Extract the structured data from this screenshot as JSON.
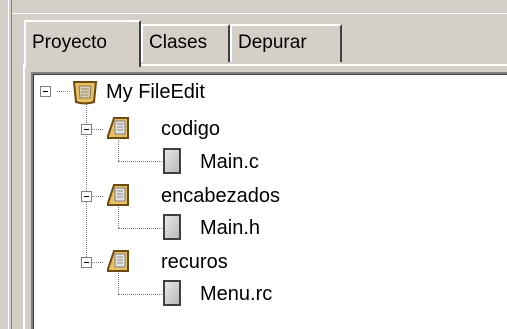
{
  "tabs": [
    {
      "label": "Proyecto",
      "active": true
    },
    {
      "label": "Clases",
      "active": false
    },
    {
      "label": "Depurar",
      "active": false
    }
  ],
  "tree": {
    "root": {
      "label": "My FileEdit",
      "icon": "project-icon",
      "expanded": true
    },
    "groups": [
      {
        "label": "codigo",
        "icon": "folder-icon",
        "expanded": true,
        "child": {
          "label": "Main.c",
          "icon": "file-icon"
        }
      },
      {
        "label": "encabezados",
        "icon": "folder-icon",
        "expanded": true,
        "child": {
          "label": "Main.h",
          "icon": "file-icon"
        }
      },
      {
        "label": "recuros",
        "icon": "folder-icon",
        "expanded": true,
        "child": {
          "label": "Menu.rc",
          "icon": "file-icon"
        }
      }
    ]
  },
  "colors": {
    "face": "#d4d0c8",
    "highlight": "#ffffff",
    "shadow": "#808080",
    "folder": "#e8c060",
    "folder_dark": "#a0782c"
  }
}
